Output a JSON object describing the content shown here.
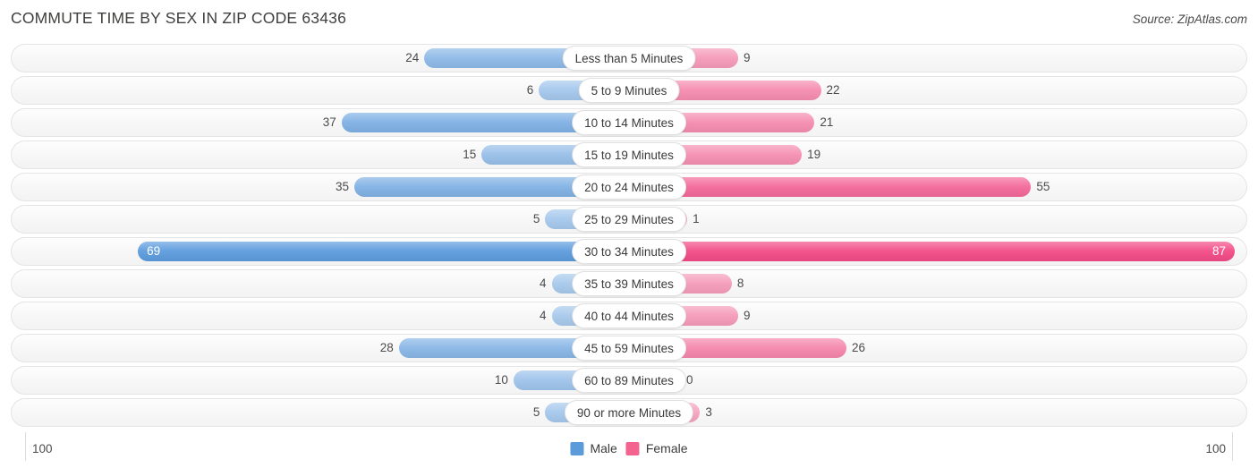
{
  "header": {
    "title": "COMMUTE TIME BY SEX IN ZIP CODE 63436",
    "source": "Source: ZipAtlas.com"
  },
  "legend": {
    "male_label": "Male",
    "female_label": "Female",
    "male_color": "#5b9bd9",
    "female_color": "#f4628f"
  },
  "axis": {
    "left_label": "100",
    "right_label": "100",
    "max": 100
  },
  "chart_data": {
    "type": "bar",
    "title": "COMMUTE TIME BY SEX IN ZIP CODE 63436",
    "subtype": "diverging-bidirectional",
    "xlabel": "",
    "ylabel": "",
    "xlim": [
      100,
      100
    ],
    "grid": false,
    "legend_position": "bottom-center",
    "categories": [
      "Less than 5 Minutes",
      "5 to 9 Minutes",
      "10 to 14 Minutes",
      "15 to 19 Minutes",
      "20 to 24 Minutes",
      "25 to 29 Minutes",
      "30 to 34 Minutes",
      "35 to 39 Minutes",
      "40 to 44 Minutes",
      "45 to 59 Minutes",
      "60 to 89 Minutes",
      "90 or more Minutes"
    ],
    "series": [
      {
        "name": "Male",
        "direction": "left",
        "color": "#5b9bd9",
        "values": [
          24,
          6,
          37,
          15,
          35,
          5,
          69,
          4,
          4,
          28,
          10,
          5
        ]
      },
      {
        "name": "Female",
        "direction": "right",
        "color": "#f4628f",
        "values": [
          9,
          22,
          21,
          19,
          55,
          1,
          87,
          8,
          9,
          26,
          0,
          3
        ]
      }
    ]
  }
}
